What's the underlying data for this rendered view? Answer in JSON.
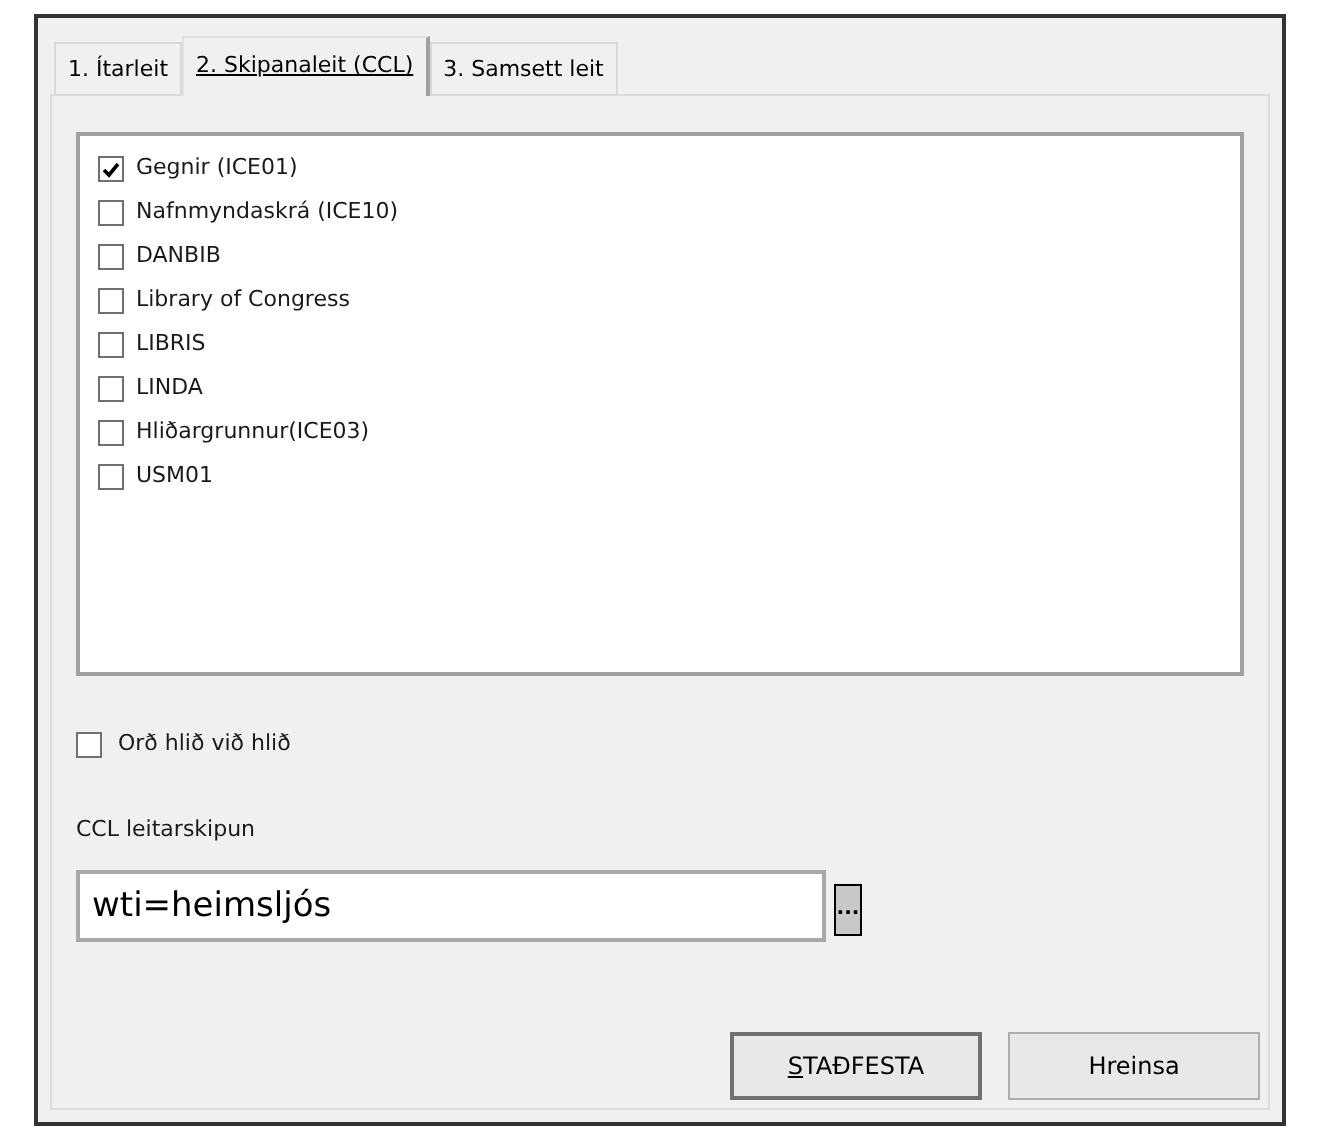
{
  "tabs": [
    {
      "label": "1. Ítarleit",
      "selected": false
    },
    {
      "label": "2. Skipanaleit (CCL)",
      "selected": true
    },
    {
      "label": "3. Samsett leit",
      "selected": false
    }
  ],
  "databases": [
    {
      "label": "Gegnir (ICE01)",
      "checked": true
    },
    {
      "label": "Nafnmyndaskrá (ICE10)",
      "checked": false
    },
    {
      "label": "DANBIB",
      "checked": false
    },
    {
      "label": "Library of Congress",
      "checked": false
    },
    {
      "label": "LIBRIS",
      "checked": false
    },
    {
      "label": "LINDA",
      "checked": false
    },
    {
      "label": "Hliðargrunnur(ICE03)",
      "checked": false
    },
    {
      "label": "USM01",
      "checked": false
    }
  ],
  "adjacent_words": {
    "label": "Orð hlið við hlið",
    "checked": false
  },
  "ccl_field": {
    "label": "CCL leitarskipun",
    "value": "wti=heimsljós",
    "browse_label": "..."
  },
  "buttons": [
    {
      "label": "STAÐFESTA",
      "default": true
    },
    {
      "label": "Hreinsa",
      "default": false
    }
  ]
}
